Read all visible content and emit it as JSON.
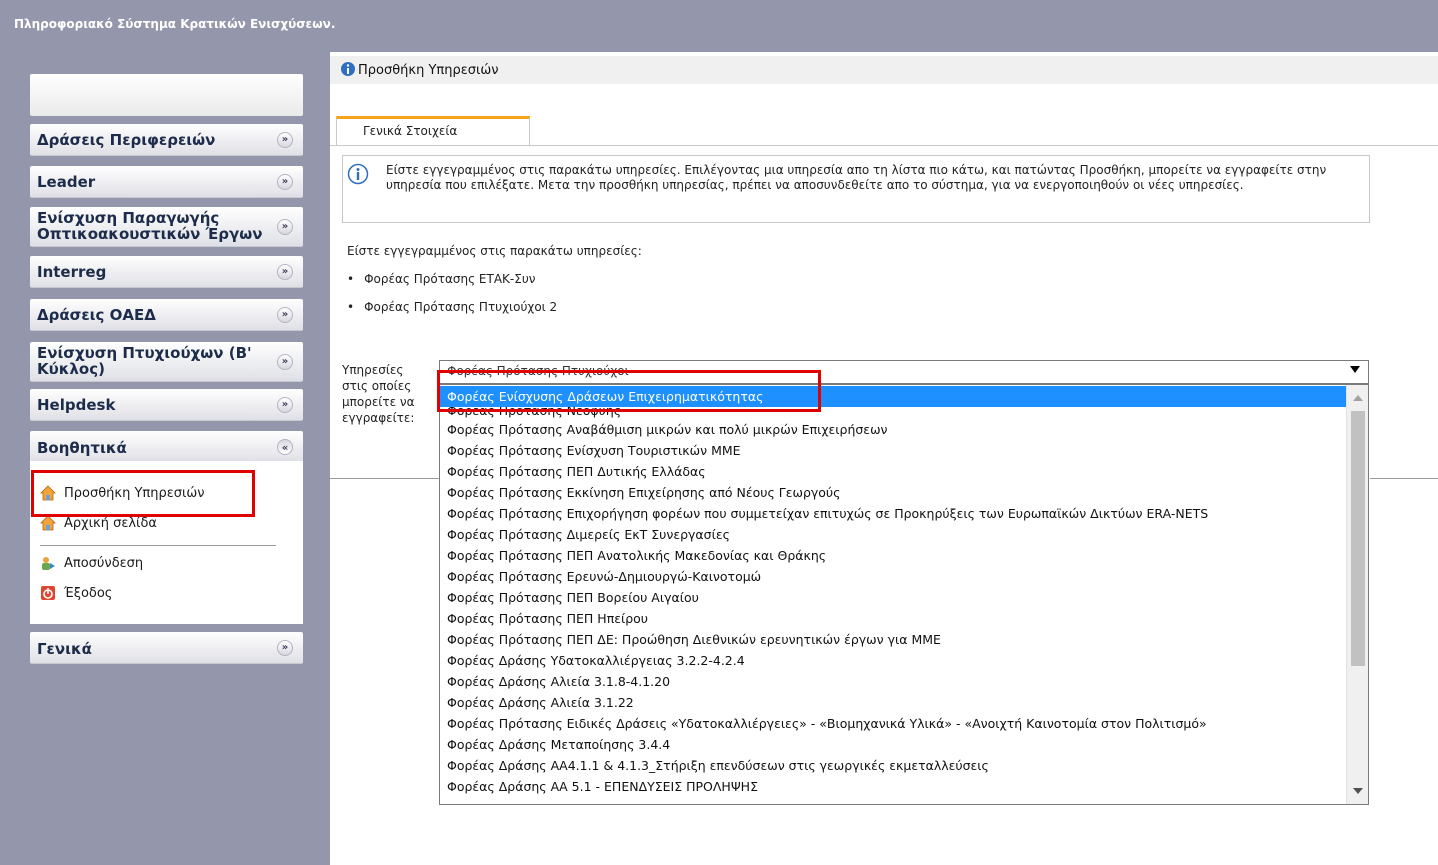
{
  "app": {
    "title": "Πληροφοριακό Σύστημα Κρατικών Ενισχύσεων."
  },
  "sidebar": {
    "sections": [
      {
        "label": "Δράσεις Περιφερειών"
      },
      {
        "label": "Leader"
      },
      {
        "label_line1": "Ενίσχυση Παραγωγής",
        "label_line2": "Οπτικοακουστικών Έργων"
      },
      {
        "label": "Interreg"
      },
      {
        "label": "Δράσεις ΟΑΕΔ"
      },
      {
        "label_line1": "Ενίσχυση Πτυχιούχων (Β'",
        "label_line2": "Κύκλος)"
      },
      {
        "label": "Helpdesk"
      },
      {
        "label": "Βοηθητικά"
      },
      {
        "label": "Γενικά"
      }
    ],
    "tools": [
      {
        "label": "Προσθήκη Υπηρεσιών",
        "icon": "home-icon"
      },
      {
        "label": "Αρχική σελίδα",
        "icon": "home-icon"
      },
      {
        "label": "Αποσύνδεση",
        "icon": "logout-icon"
      },
      {
        "label": "Έξοδος",
        "icon": "power-icon"
      }
    ]
  },
  "main": {
    "page_title": "Προσθήκη Υπηρεσιών",
    "tab_label": "Γενικά Στοιχεία",
    "info_text": "Είστε εγγεγραμμένος στις παρακάτω υπηρεσίες. Επιλέγοντας μια υπηρεσία απο τη λίστα πιο κάτω, και πατώντας Προσθήκη, μπορείτε να εγγραφείτε στην υπηρεσία που επιλέξατε. Μετα την προσθήκη υπηρεσίας, πρέπει να αποσυνδεθείτε απο το σύστημα, για να ενεργοποιηθούν οι νέες υπηρεσίες.",
    "registered_title": "Είστε εγγεγραμμένος στις παρακάτω υπηρεσίες:",
    "registered": [
      "Φορέας Πρότασης ΕΤΑΚ-Συν",
      "Φορέας Πρότασης Πτυχιούχοι 2"
    ],
    "services_label": "Υπηρεσίες στις οποίες μπορείτε να εγγραφείτε:",
    "select_value": "Φορέας Πρότασης Πτυχιούχοι",
    "options": [
      "Φορέας Ενίσχυσης Δράσεων Επιχειρηματικότητας",
      "Φορέας Πρότασης Νεοφυής",
      "Φορέας Πρότασης Αναβάθμιση μικρών και πολύ μικρών Επιχειρήσεων",
      "Φορέας Πρότασης Ενίσχυση Τουριστικών ΜΜΕ",
      "Φορέας Πρότασης ΠΕΠ Δυτικής Ελλάδας",
      "Φορέας Πρότασης Εκκίνηση Επιχείρησης από Νέους Γεωργούς",
      "Φορέας Πρότασης Επιχορήγηση φορέων που συμμετείχαν επιτυχώς σε Προκηρύξεις των Ευρωπαϊκών Δικτύων ERA-NETS",
      "Φορέας Πρότασης Διμερείς ΕκΤ Συνεργασίες",
      "Φορέας Πρότασης ΠΕΠ Ανατολικής Μακεδονίας και Θράκης",
      "Φορέας Πρότασης Ερευνώ-Δημιουργώ-Καινοτομώ",
      "Φορέας Πρότασης ΠΕΠ Βορείου Αιγαίου",
      "Φορέας Πρότασης ΠΕΠ Ηπείρου",
      "Φορέας Πρότασης ΠΕΠ ΔΕ: Προώθηση Διεθνικών ερευνητικών έργων για ΜΜΕ",
      "Φορέας Δράσης Υδατοκαλλιέργειας 3.2.2-4.2.4",
      "Φορέας Δράσης Αλιεία 3.1.8-4.1.20",
      "Φορέας Δράσης Αλιεία 3.1.22",
      "Φορέας Πρότασης Ειδικές Δράσεις «Υδατοκαλλιέργειες» - «Βιομηχανικά Υλικά» - «Ανοιχτή Καινοτομία στον Πολιτισμό»",
      "Φορέας Δράσης Μεταποίησης 3.4.4",
      "Φορέας Δράσης ΑΑ4.1.1 & 4.1.3_Στήριξη επενδύσεων στις γεωργικές εκμεταλλεύσεις",
      "Φορέας Δράσης ΑΑ 5.1 - ΕΠΕΝΔΥΣΕΙΣ ΠΡΟΛΗΨΗΣ"
    ]
  },
  "colors": {
    "chrome": "#9496ab",
    "highlight": "#1e90ff",
    "annotation": "#e00000",
    "tab_accent": "#f7a21b"
  }
}
